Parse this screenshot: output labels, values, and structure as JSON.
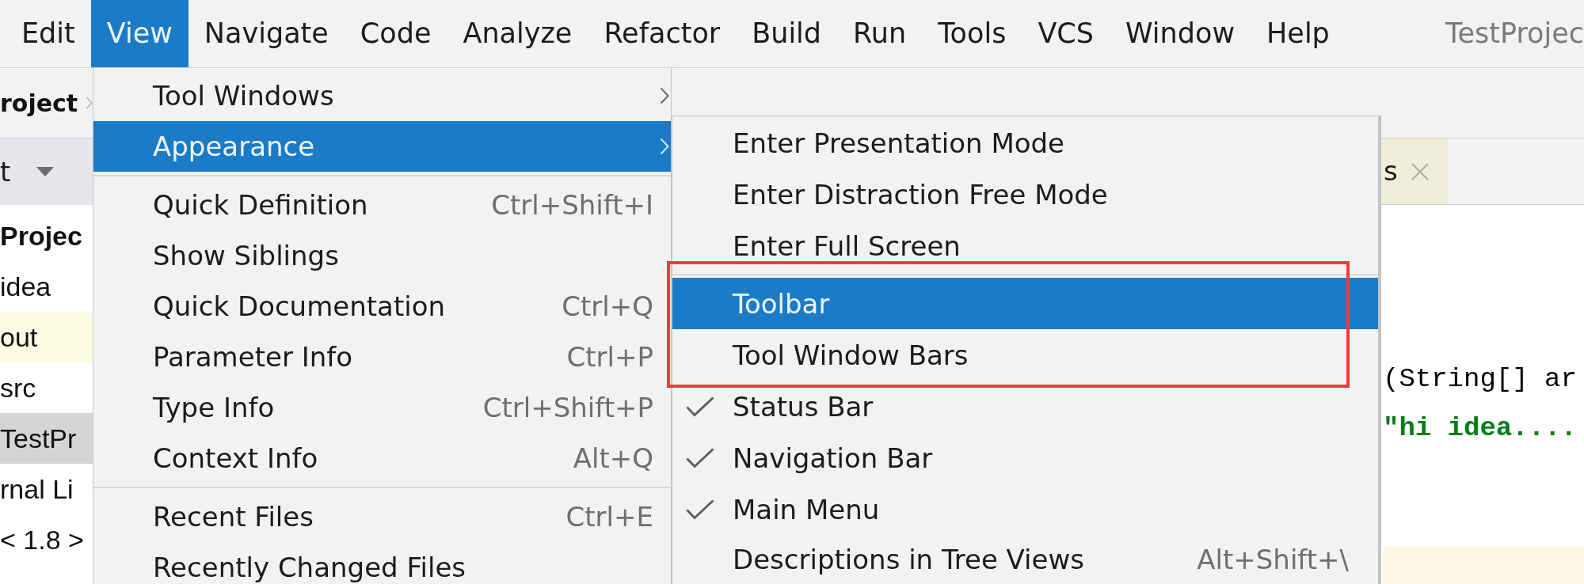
{
  "menu_bar": {
    "items": [
      {
        "label": "Edit",
        "selected": false
      },
      {
        "label": "View",
        "selected": true
      },
      {
        "label": "Navigate",
        "selected": false
      },
      {
        "label": "Code",
        "selected": false
      },
      {
        "label": "Analyze",
        "selected": false
      },
      {
        "label": "Refactor",
        "selected": false
      },
      {
        "label": "Build",
        "selected": false
      },
      {
        "label": "Run",
        "selected": false
      },
      {
        "label": "Tools",
        "selected": false
      },
      {
        "label": "VCS",
        "selected": false
      },
      {
        "label": "Window",
        "selected": false
      },
      {
        "label": "Help",
        "selected": false
      }
    ],
    "title": "TestProjec"
  },
  "navigation_bar": {
    "crumb": "roject"
  },
  "project_panel": {
    "title": "t",
    "items": [
      {
        "label": "Projec",
        "kind": "root",
        "selected": false,
        "excluded": false
      },
      {
        "label": "idea",
        "kind": "node",
        "selected": false,
        "excluded": false
      },
      {
        "label": "out",
        "kind": "node",
        "selected": false,
        "excluded": true
      },
      {
        "label": "src",
        "kind": "node",
        "selected": false,
        "excluded": false
      },
      {
        "label": "TestPr",
        "kind": "node",
        "selected": true,
        "excluded": false
      },
      {
        "label": "rnal Li",
        "kind": "node",
        "selected": false,
        "excluded": false
      },
      {
        "label": "< 1.8 >",
        "kind": "node",
        "selected": false,
        "excluded": false
      }
    ]
  },
  "editor": {
    "tabs": [
      {
        "label": "s"
      }
    ],
    "lines": [
      {
        "kind": "code",
        "text": "(String[] ar"
      },
      {
        "kind": "string",
        "text": "\"hi idea...."
      }
    ]
  },
  "view_menu": {
    "items": [
      {
        "kind": "item",
        "label": "Tool Windows",
        "has_submenu": true,
        "selected": false
      },
      {
        "kind": "item",
        "label": "Appearance",
        "has_submenu": true,
        "selected": true
      },
      {
        "kind": "separator"
      },
      {
        "kind": "item",
        "label": "Quick Definition",
        "shortcut": "Ctrl+Shift+I",
        "has_submenu": false,
        "selected": false
      },
      {
        "kind": "item",
        "label": "Show Siblings",
        "has_submenu": false,
        "selected": false
      },
      {
        "kind": "item",
        "label": "Quick Documentation",
        "shortcut": "Ctrl+Q",
        "has_submenu": false,
        "selected": false
      },
      {
        "kind": "item",
        "label": "Parameter Info",
        "shortcut": "Ctrl+P",
        "has_submenu": false,
        "selected": false
      },
      {
        "kind": "item",
        "label": "Type Info",
        "shortcut": "Ctrl+Shift+P",
        "has_submenu": false,
        "selected": false
      },
      {
        "kind": "item",
        "label": "Context Info",
        "shortcut": "Alt+Q",
        "has_submenu": false,
        "selected": false
      },
      {
        "kind": "separator"
      },
      {
        "kind": "item",
        "label": "Recent Files",
        "shortcut": "Ctrl+E",
        "has_submenu": false,
        "selected": false
      },
      {
        "kind": "item",
        "label": "Recently Changed Files",
        "has_submenu": false,
        "selected": false
      }
    ]
  },
  "appearance_submenu": {
    "items": [
      {
        "kind": "item",
        "label": "Enter Presentation Mode",
        "checked": false,
        "selected": false
      },
      {
        "kind": "item",
        "label": "Enter Distraction Free Mode",
        "checked": false,
        "selected": false
      },
      {
        "kind": "item",
        "label": "Enter Full Screen",
        "checked": false,
        "selected": false
      },
      {
        "kind": "separator"
      },
      {
        "kind": "item",
        "label": "Toolbar",
        "checked": false,
        "selected": true
      },
      {
        "kind": "item",
        "label": "Tool Window Bars",
        "checked": false,
        "selected": false
      },
      {
        "kind": "item",
        "label": "Status Bar",
        "checked": true,
        "selected": false
      },
      {
        "kind": "item",
        "label": "Navigation Bar",
        "checked": true,
        "selected": false
      },
      {
        "kind": "item",
        "label": "Main Menu",
        "checked": true,
        "selected": false
      },
      {
        "kind": "item",
        "label": "Descriptions in Tree Views",
        "shortcut": "Alt+Shift+\\",
        "checked": false,
        "selected": false
      }
    ]
  }
}
